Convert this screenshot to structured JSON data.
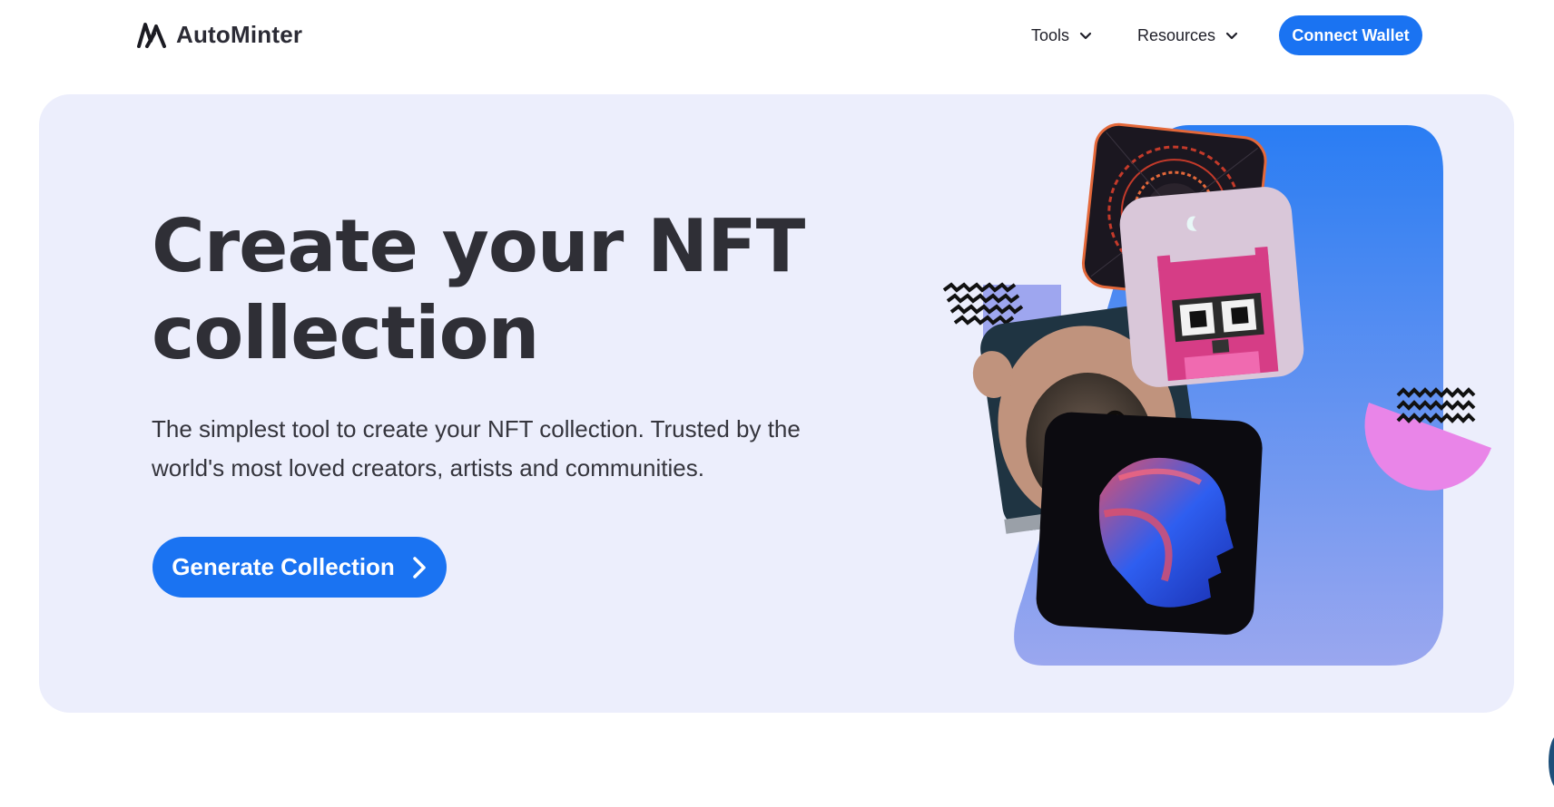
{
  "nav": {
    "brand_name": "AutoMinter",
    "tools_label": "Tools",
    "resources_label": "Resources",
    "connect_label": "Connect Wallet"
  },
  "hero": {
    "title": "Create your NFT collection",
    "subtitle": "The simplest tool to create your NFT collection. Trusted by the world's most loved creators, artists and communities.",
    "cta_label": "Generate Collection"
  },
  "icons": {
    "brand": "autominter-logo-icon",
    "dropdown": "chevron-down-icon",
    "cta_arrow": "chevron-right-icon"
  },
  "colors": {
    "accent": "#1a73f2",
    "hero_bg": "#eceefc",
    "text": "#2f2f36"
  }
}
